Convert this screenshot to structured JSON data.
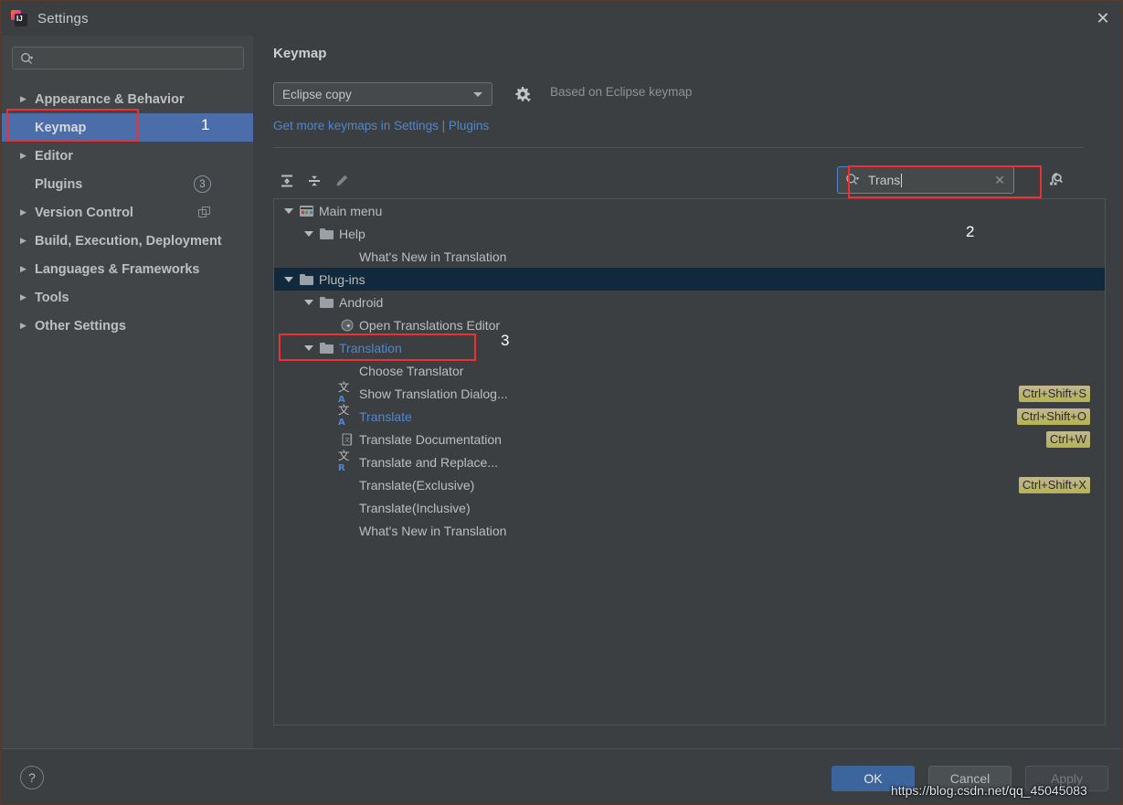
{
  "window": {
    "title": "Settings",
    "app_icon": "intellij-idea-icon",
    "close_icon": "close-icon"
  },
  "sidebar": {
    "search": {
      "placeholder": "",
      "value": "",
      "icon": "search-icon"
    },
    "items": [
      {
        "label": "Appearance & Behavior",
        "expandable": true,
        "selected": false,
        "badge": "",
        "trailing_icon": ""
      },
      {
        "label": "Keymap",
        "expandable": false,
        "selected": true,
        "badge": "",
        "trailing_icon": ""
      },
      {
        "label": "Editor",
        "expandable": true,
        "selected": false,
        "badge": "",
        "trailing_icon": ""
      },
      {
        "label": "Plugins",
        "expandable": false,
        "selected": false,
        "badge": "3",
        "trailing_icon": ""
      },
      {
        "label": "Version Control",
        "expandable": true,
        "selected": false,
        "badge": "",
        "trailing_icon": "copy-icon"
      },
      {
        "label": "Build, Execution, Deployment",
        "expandable": true,
        "selected": false,
        "badge": "",
        "trailing_icon": ""
      },
      {
        "label": "Languages & Frameworks",
        "expandable": true,
        "selected": false,
        "badge": "",
        "trailing_icon": ""
      },
      {
        "label": "Tools",
        "expandable": true,
        "selected": false,
        "badge": "",
        "trailing_icon": ""
      },
      {
        "label": "Other Settings",
        "expandable": true,
        "selected": false,
        "badge": "",
        "trailing_icon": ""
      }
    ]
  },
  "pane": {
    "title": "Keymap",
    "keymap_select": {
      "value": "Eclipse copy",
      "caret_icon": "chevron-down-icon"
    },
    "gear_icon": "gear-icon",
    "based_on": "Based on Eclipse keymap",
    "get_more_link": "Get more keymaps in Settings | Plugins",
    "toolbar": {
      "expand_all_icon": "expand-all-icon",
      "collapse_all_icon": "collapse-all-icon",
      "edit_shortcut_icon": "pencil-edit-icon"
    },
    "search": {
      "value": "Trans",
      "placeholder": "",
      "search_icon": "search-icon",
      "clear_icon": "clear-x-icon"
    },
    "find_by_shortcut_icon": "find-by-shortcut-icon"
  },
  "tree": [
    {
      "label": "Main menu",
      "indent": 0,
      "arrow": "down",
      "icon": "main-menu-icon",
      "keys": "",
      "selected": false,
      "link": false
    },
    {
      "label": "Help",
      "indent": 1,
      "arrow": "down",
      "icon": "folder-icon",
      "keys": "",
      "selected": false,
      "link": false
    },
    {
      "label": "What's New in Translation",
      "indent": 2,
      "arrow": "",
      "icon": "",
      "keys": "",
      "selected": false,
      "link": false
    },
    {
      "label": "Plug-ins",
      "indent": 0,
      "arrow": "down",
      "icon": "folder-icon",
      "keys": "",
      "selected": true,
      "link": false
    },
    {
      "label": "Android",
      "indent": 1,
      "arrow": "down",
      "icon": "folder-icon",
      "keys": "",
      "selected": false,
      "link": false
    },
    {
      "label": "Open Translations Editor",
      "indent": 2,
      "arrow": "",
      "icon": "translations-editor-icon",
      "keys": "",
      "selected": false,
      "link": false
    },
    {
      "label": "Translation",
      "indent": 1,
      "arrow": "down",
      "icon": "folder-icon",
      "keys": "",
      "selected": false,
      "link": true
    },
    {
      "label": "Choose Translator",
      "indent": 2,
      "arrow": "",
      "icon": "",
      "keys": "",
      "selected": false,
      "link": false
    },
    {
      "label": "Show Translation Dialog...",
      "indent": 2,
      "arrow": "",
      "icon": "translate-a-icon",
      "keys": "Ctrl+Shift+S",
      "selected": false,
      "link": false
    },
    {
      "label": "Translate",
      "indent": 2,
      "arrow": "",
      "icon": "translate-a-icon",
      "keys": "Ctrl+Shift+O",
      "selected": false,
      "link": true
    },
    {
      "label": "Translate Documentation",
      "indent": 2,
      "arrow": "",
      "icon": "translate-doc-icon",
      "keys": "Ctrl+W",
      "selected": false,
      "link": false
    },
    {
      "label": "Translate and Replace...",
      "indent": 2,
      "arrow": "",
      "icon": "translate-r-icon",
      "keys": "",
      "selected": false,
      "link": false
    },
    {
      "label": "Translate(Exclusive)",
      "indent": 2,
      "arrow": "",
      "icon": "",
      "keys": "Ctrl+Shift+X",
      "selected": false,
      "link": false
    },
    {
      "label": "Translate(Inclusive)",
      "indent": 2,
      "arrow": "",
      "icon": "",
      "keys": "",
      "selected": false,
      "link": false
    },
    {
      "label": "What's New in Translation",
      "indent": 2,
      "arrow": "",
      "icon": "",
      "keys": "",
      "selected": false,
      "link": false
    }
  ],
  "footer": {
    "help_label": "?",
    "ok_label": "OK",
    "cancel_label": "Cancel",
    "apply_label": "Apply"
  },
  "watermark": "https://blog.csdn.net/qq_45045083",
  "annotations": [
    {
      "num": "1"
    },
    {
      "num": "2"
    },
    {
      "num": "3"
    }
  ],
  "colors": {
    "accent_blue": "#4d87d0",
    "selection_blue": "#4b6eab",
    "tree_selection": "#10293d",
    "annotation_red": "#f03030",
    "shortcut_badge": "#b5b352"
  }
}
